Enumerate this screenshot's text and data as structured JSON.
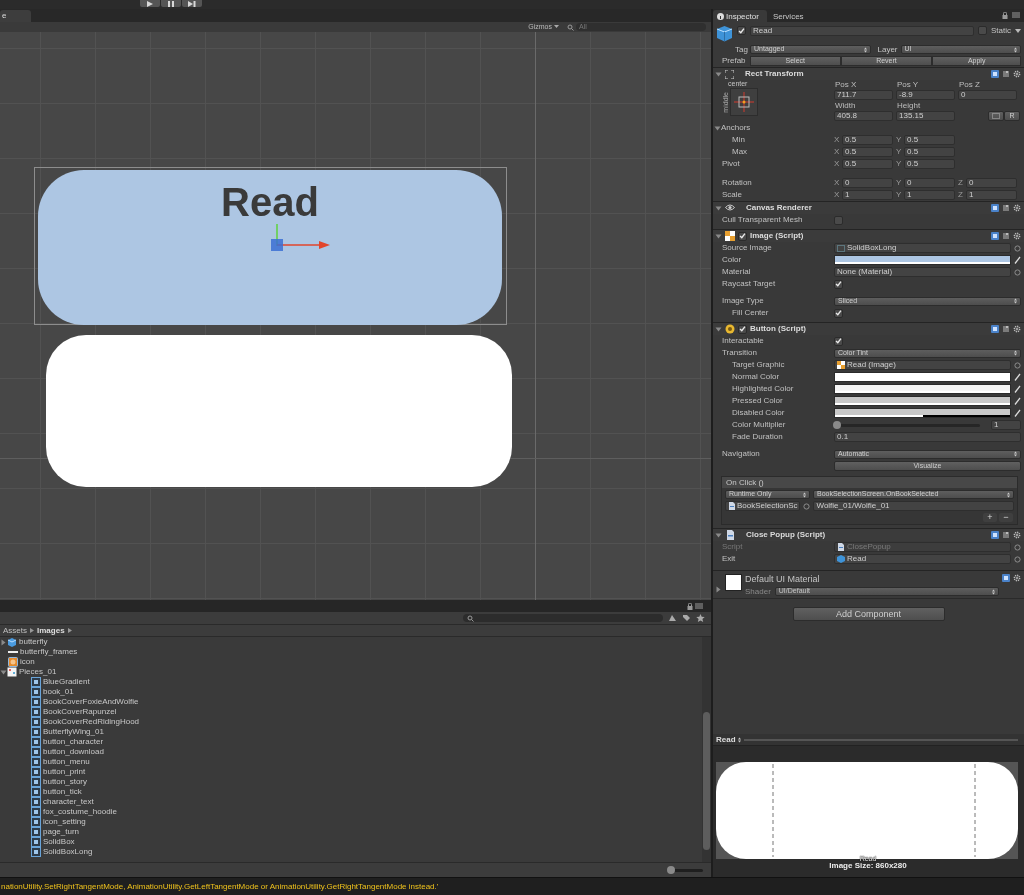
{
  "scene": {
    "tab": {
      "label": "e",
      "selected": true
    },
    "gizmos": "Gizmos",
    "search": {
      "placeholder": "All"
    },
    "objects": [
      {
        "label": "Read",
        "color": "#adc6e3",
        "selected": true
      },
      {
        "color": "#ffffff",
        "selected": false
      }
    ]
  },
  "inspector": {
    "tabs": [
      {
        "label": "Inspector",
        "selected": true
      },
      {
        "label": "Services",
        "selected": false
      }
    ],
    "object": {
      "active": true,
      "name": "Read",
      "static_label": "Static",
      "static": false,
      "tag_label": "Tag",
      "tag": "Untagged",
      "layer_label": "Layer",
      "layer": "UI",
      "prefab_label": "Prefab",
      "prefab_buttons": [
        "Select",
        "Revert",
        "Apply"
      ]
    },
    "rect_transform": {
      "title": "Rect Transform",
      "expanded": true,
      "anchor_h": "center",
      "anchor_v": "middle",
      "fields": [
        {
          "label": "Pos X",
          "value": "711.7"
        },
        {
          "label": "Pos Y",
          "value": "-8.9"
        },
        {
          "label": "Pos Z",
          "value": "0"
        },
        {
          "label": "Width",
          "value": "405.8"
        },
        {
          "label": "Height",
          "value": "135.15"
        }
      ],
      "raw_button": "R",
      "anchors": {
        "label": "Anchors",
        "expanded": true,
        "rows": [
          {
            "label": "Min",
            "values": [
              {
                "axis": "X",
                "value": "0.5"
              },
              {
                "axis": "Y",
                "value": "0.5"
              }
            ]
          },
          {
            "label": "Max",
            "values": [
              {
                "axis": "X",
                "value": "0.5"
              },
              {
                "axis": "Y",
                "value": "0.5"
              }
            ]
          }
        ]
      },
      "rows": [
        {
          "label": "Pivot",
          "values": [
            {
              "axis": "X",
              "value": "0.5"
            },
            {
              "axis": "Y",
              "value": "0.5"
            }
          ]
        },
        {
          "label": "Rotation",
          "values": [
            {
              "axis": "X",
              "value": "0"
            },
            {
              "axis": "Y",
              "value": "0"
            },
            {
              "axis": "Z",
              "value": "0"
            }
          ]
        },
        {
          "label": "Scale",
          "values": [
            {
              "axis": "X",
              "value": "1"
            },
            {
              "axis": "Y",
              "value": "1"
            },
            {
              "axis": "Z",
              "value": "1"
            }
          ]
        }
      ]
    },
    "components": [
      {
        "kind": "eye",
        "title": "Canvas Renderer",
        "expanded": true,
        "rows": [
          {
            "kind": "check",
            "label": "Cull Transparent Mesh",
            "checked": false
          }
        ]
      },
      {
        "kind": "image",
        "title": "Image (Script)",
        "enabled": true,
        "expanded": true,
        "rows": [
          {
            "kind": "object",
            "label": "Source Image",
            "value": "SolidBoxLong"
          },
          {
            "kind": "color",
            "label": "Color",
            "color": "#adc6e3",
            "level": 1
          },
          {
            "kind": "object",
            "label": "Material",
            "value": "None (Material)"
          },
          {
            "kind": "check",
            "label": "Raycast Target",
            "checked": true
          },
          {
            "kind": "dropdown",
            "label": "Image Type",
            "value": "Sliced",
            "children": [
              {
                "kind": "check",
                "label": "Fill Center",
                "checked": true
              }
            ]
          }
        ]
      },
      {
        "kind": "button",
        "title": "Button (Script)",
        "enabled": true,
        "expanded": true,
        "rows": [
          {
            "kind": "check",
            "label": "Interactable",
            "checked": true
          },
          {
            "kind": "dropdown",
            "label": "Transition",
            "value": "Color Tint",
            "children": [
              {
                "kind": "object",
                "label": "Target Graphic",
                "value": "Read (Image)"
              },
              {
                "kind": "color",
                "label": "Normal Color",
                "color": "#ffffff",
                "level": 1
              },
              {
                "kind": "color",
                "label": "Highlighted Color",
                "color": "#f5f5f5",
                "level": 1
              },
              {
                "kind": "color",
                "label": "Pressed Color",
                "color": "#c8c8c8",
                "level": 1
              },
              {
                "kind": "color",
                "label": "Disabled Color",
                "color": "#c8c8c8",
                "level": 0.5
              },
              {
                "kind": "slider",
                "label": "Color Multiplier",
                "level": 0,
                "value": "1"
              },
              {
                "kind": "text",
                "label": "Fade Duration",
                "value": "0.1"
              }
            ]
          },
          {
            "kind": "dropdown",
            "label": "Navigation",
            "value": "Automatic"
          },
          {
            "kind": "button",
            "label": "Visualize"
          }
        ],
        "event": {
          "title": "On Click ()",
          "mode": "Runtime Only",
          "function": "BookSelectionScreen.OnBookSelected",
          "target": "BookSelectionSc",
          "argument": "Wolfie_01/Wolfie_01",
          "add": "+",
          "remove": "−"
        }
      },
      {
        "kind": "script",
        "title": "Close Popup (Script)",
        "expanded": true,
        "rows": [
          {
            "kind": "object",
            "label": "Script",
            "value": "ClosePopup",
            "disabled": true
          },
          {
            "kind": "object",
            "label": "Exit",
            "value": "Read",
            "disabled": false
          }
        ]
      }
    ],
    "material": {
      "name": "Default UI Material",
      "expanded": false,
      "shader_label": "Shader",
      "shader": "UI/Default"
    },
    "add_component": "Add Component",
    "preview": {
      "title": "Read",
      "caption": "Read",
      "image_size": "Image Size: 860x280"
    }
  },
  "project": {
    "breadcrumb": [
      "Assets",
      "Images"
    ],
    "size_slider": {
      "level": 0
    },
    "items": [
      {
        "kind": "prefab",
        "name": "butterfly",
        "expanded": false
      },
      {
        "kind": "strip",
        "name": "butterfly_frames"
      },
      {
        "kind": "texture",
        "name": "icon"
      },
      {
        "kind": "sheet",
        "name": "Pieces_01",
        "expanded": true,
        "children": [
          {
            "kind": "sprite",
            "name": "BlueGradient"
          },
          {
            "kind": "sprite",
            "name": "book_01"
          },
          {
            "kind": "sprite",
            "name": "BookCoverFoxieAndWolfie"
          },
          {
            "kind": "sprite",
            "name": "BookCoverRapunzel"
          },
          {
            "kind": "sprite",
            "name": "BookCoverRedRidingHood"
          },
          {
            "kind": "sprite",
            "name": "ButterflyWing_01"
          },
          {
            "kind": "sprite",
            "name": "button_character"
          },
          {
            "kind": "sprite",
            "name": "button_download"
          },
          {
            "kind": "sprite",
            "name": "button_menu"
          },
          {
            "kind": "sprite",
            "name": "button_print"
          },
          {
            "kind": "sprite",
            "name": "button_story"
          },
          {
            "kind": "sprite",
            "name": "button_tick"
          },
          {
            "kind": "sprite",
            "name": "character_text"
          },
          {
            "kind": "sprite",
            "name": "fox_costume_hoodie"
          },
          {
            "kind": "sprite",
            "name": "icon_setting"
          },
          {
            "kind": "sprite",
            "name": "page_turn"
          },
          {
            "kind": "sprite",
            "name": "SolidBox"
          },
          {
            "kind": "sprite",
            "name": "SolidBoxLong"
          }
        ]
      }
    ]
  },
  "console": {
    "message": "nationUtility.SetRightTangentMode, AnimationUtility.GetLeftTangentMode or AnimationUtility.GetRightTangentMode instead.'"
  }
}
